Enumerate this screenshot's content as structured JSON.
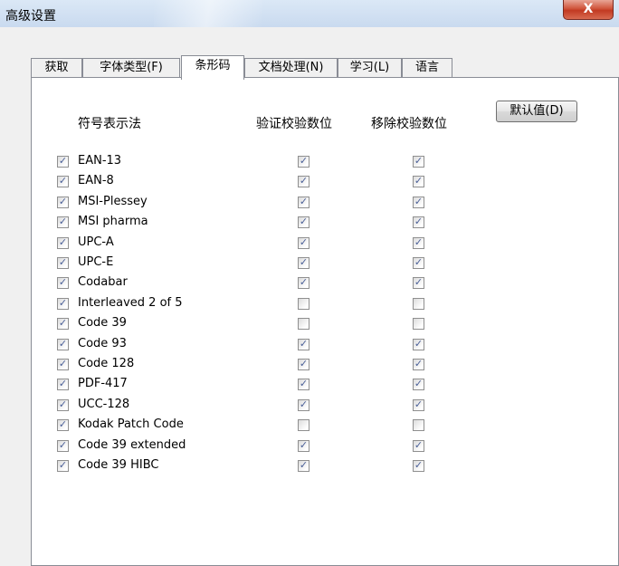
{
  "window": {
    "title": "高级设置",
    "close_label": "X"
  },
  "tabs": [
    {
      "label": "获取",
      "active": false
    },
    {
      "label": "字体类型(F)",
      "active": false
    },
    {
      "label": "条形码",
      "active": true
    },
    {
      "label": "文档处理(N)",
      "active": false
    },
    {
      "label": "学习(L)",
      "active": false
    },
    {
      "label": "语言",
      "active": false
    }
  ],
  "headers": {
    "symbology": "符号表示法",
    "verify": "验证校验数位",
    "remove": "移除校验数位"
  },
  "default_button": "默认值(D)",
  "rows": [
    {
      "name": "EAN-13",
      "enabled": true,
      "verify": true,
      "remove": true
    },
    {
      "name": "EAN-8",
      "enabled": true,
      "verify": true,
      "remove": true
    },
    {
      "name": "MSI-Plessey",
      "enabled": true,
      "verify": true,
      "remove": true
    },
    {
      "name": "MSI pharma",
      "enabled": true,
      "verify": true,
      "remove": true
    },
    {
      "name": "UPC-A",
      "enabled": true,
      "verify": true,
      "remove": true
    },
    {
      "name": "UPC-E",
      "enabled": true,
      "verify": true,
      "remove": true
    },
    {
      "name": "Codabar",
      "enabled": true,
      "verify": true,
      "remove": true
    },
    {
      "name": "Interleaved 2 of 5",
      "enabled": true,
      "verify": false,
      "remove": false
    },
    {
      "name": "Code 39",
      "enabled": true,
      "verify": false,
      "remove": false
    },
    {
      "name": "Code 93",
      "enabled": true,
      "verify": true,
      "remove": true
    },
    {
      "name": "Code 128",
      "enabled": true,
      "verify": true,
      "remove": true
    },
    {
      "name": "PDF-417",
      "enabled": true,
      "verify": true,
      "remove": true
    },
    {
      "name": "UCC-128",
      "enabled": true,
      "verify": true,
      "remove": true
    },
    {
      "name": "Kodak Patch Code",
      "enabled": true,
      "verify": false,
      "remove": false
    },
    {
      "name": "Code 39 extended",
      "enabled": true,
      "verify": true,
      "remove": true
    },
    {
      "name": "Code 39 HIBC",
      "enabled": true,
      "verify": true,
      "remove": true
    }
  ]
}
